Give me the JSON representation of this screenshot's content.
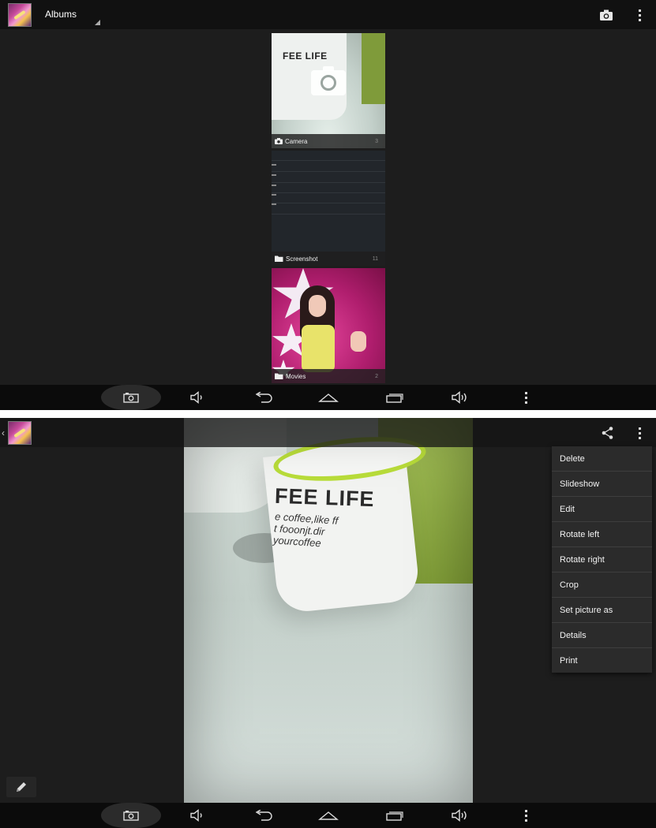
{
  "screen1": {
    "action_bar": {
      "title": "Albums",
      "icons": [
        "gallery-app-icon",
        "camera-icon",
        "overflow-menu-icon"
      ]
    },
    "albums": [
      {
        "name": "Camera",
        "count": "3",
        "icon": "camera-icon"
      },
      {
        "name": "Screenshot",
        "count": "11",
        "icon": "folder-icon"
      },
      {
        "name": "Movies",
        "count": "2",
        "icon": "folder-icon"
      }
    ]
  },
  "screen2": {
    "action_bar": {
      "icons": [
        "gallery-app-icon",
        "share-icon",
        "overflow-menu-icon"
      ]
    },
    "photo": {
      "mug_text_line1": "FEE LIFE",
      "mug_text_line2": "e coffee,like ff",
      "mug_text_line3": "t fooonjt.dir",
      "mug_text_line4": "yourcoffee"
    },
    "menu": {
      "items": [
        "Delete",
        "Slideshow",
        "Edit",
        "Rotate left",
        "Rotate right",
        "Crop",
        "Set picture as",
        "Details",
        "Print"
      ]
    },
    "edit_button_icon": "pencil-icon"
  },
  "navigation_bar": {
    "buttons": [
      "screenshot-icon",
      "volume-down-icon",
      "back-icon",
      "home-icon",
      "recent-apps-icon",
      "volume-up-icon",
      "menu-icon"
    ]
  },
  "colors": {
    "action_bar": "#111111",
    "background": "#1d1d1d",
    "menu_bg": "#2b2b2b",
    "nav_bar": "#0b0b0b"
  }
}
